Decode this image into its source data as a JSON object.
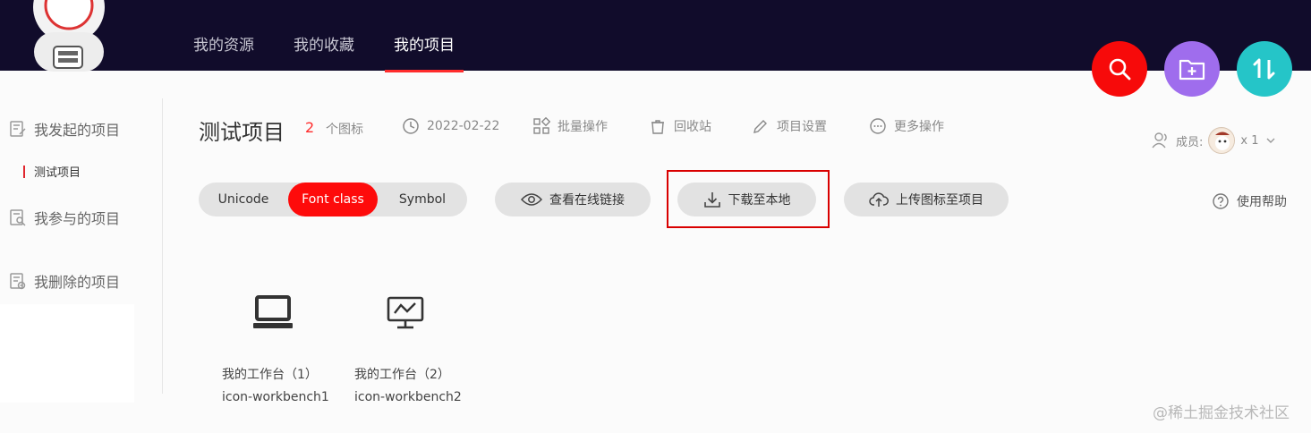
{
  "header": {
    "nav": [
      "我的资源",
      "我的收藏",
      "我的项目"
    ],
    "active_nav": "我的项目",
    "actions": [
      {
        "name": "search",
        "color": "#f70a0a"
      },
      {
        "name": "new-folder",
        "color": "#9f6ded"
      },
      {
        "name": "sort",
        "color": "#25c5c8"
      }
    ]
  },
  "sidebar": {
    "initiated": "我发起的项目",
    "initiated_sub": "测试项目",
    "participated": "我参与的项目",
    "deleted": "我删除的项目"
  },
  "project": {
    "title": "测试项目",
    "icon_count": "2",
    "icon_count_label": "个图标",
    "date": "2022-02-22",
    "batch": "批量操作",
    "recycle": "回收站",
    "settings": "项目设置",
    "more": "更多操作",
    "members_label": "成员:",
    "members_count": "x 1",
    "help": "使用帮助"
  },
  "toolbar": {
    "formats": [
      "Unicode",
      "Font class",
      "Symbol"
    ],
    "active_format": "Font class",
    "view_link": "查看在线链接",
    "download": "下载至本地",
    "upload": "上传图标至项目"
  },
  "icons": [
    {
      "name": "我的工作台（1）",
      "code": "icon-workbench1"
    },
    {
      "name": "我的工作台（2）",
      "code": "icon-workbench2"
    }
  ],
  "watermark": "@稀土掘金技术社区",
  "colors": {
    "header_bg": "#110c2b",
    "accent_red": "#fe0b0b"
  }
}
